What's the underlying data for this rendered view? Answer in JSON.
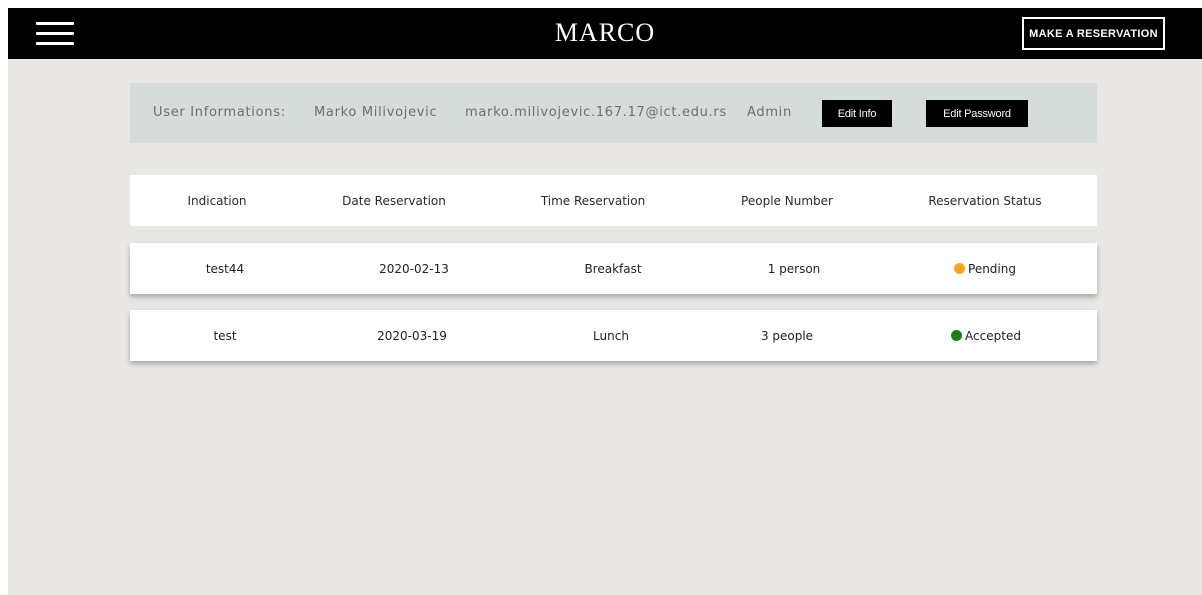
{
  "header": {
    "brand": "MARCO",
    "reserve_label": "MAKE A RESERVATION",
    "menu_icon": "hamburger-icon"
  },
  "user_info": {
    "label": "User Informations:",
    "name": "Marko Milivojevic",
    "email": "marko.milivojevic.167.17@ict.edu.rs",
    "role": "Admin",
    "edit_info_label": "Edit Info",
    "edit_password_label": "Edit Password"
  },
  "table": {
    "headers": [
      "Indication",
      "Date Reservation",
      "Time Reservation",
      "People Number",
      "Reservation Status"
    ],
    "rows": [
      {
        "indication": "test44",
        "date": "2020-02-13",
        "time": "Breakfast",
        "people": "1 person",
        "status": "Pending",
        "status_color": "#f5a623"
      },
      {
        "indication": "test",
        "date": "2020-03-19",
        "time": "Lunch",
        "people": "3 people",
        "status": "Accepted",
        "status_color": "#1a7f1a"
      }
    ]
  },
  "colors": {
    "topbar": "#000000",
    "page_background": "#e9e7e3",
    "info_panel": "#d5dcd9",
    "pending": "#f5a623",
    "accepted": "#1a7f1a"
  }
}
